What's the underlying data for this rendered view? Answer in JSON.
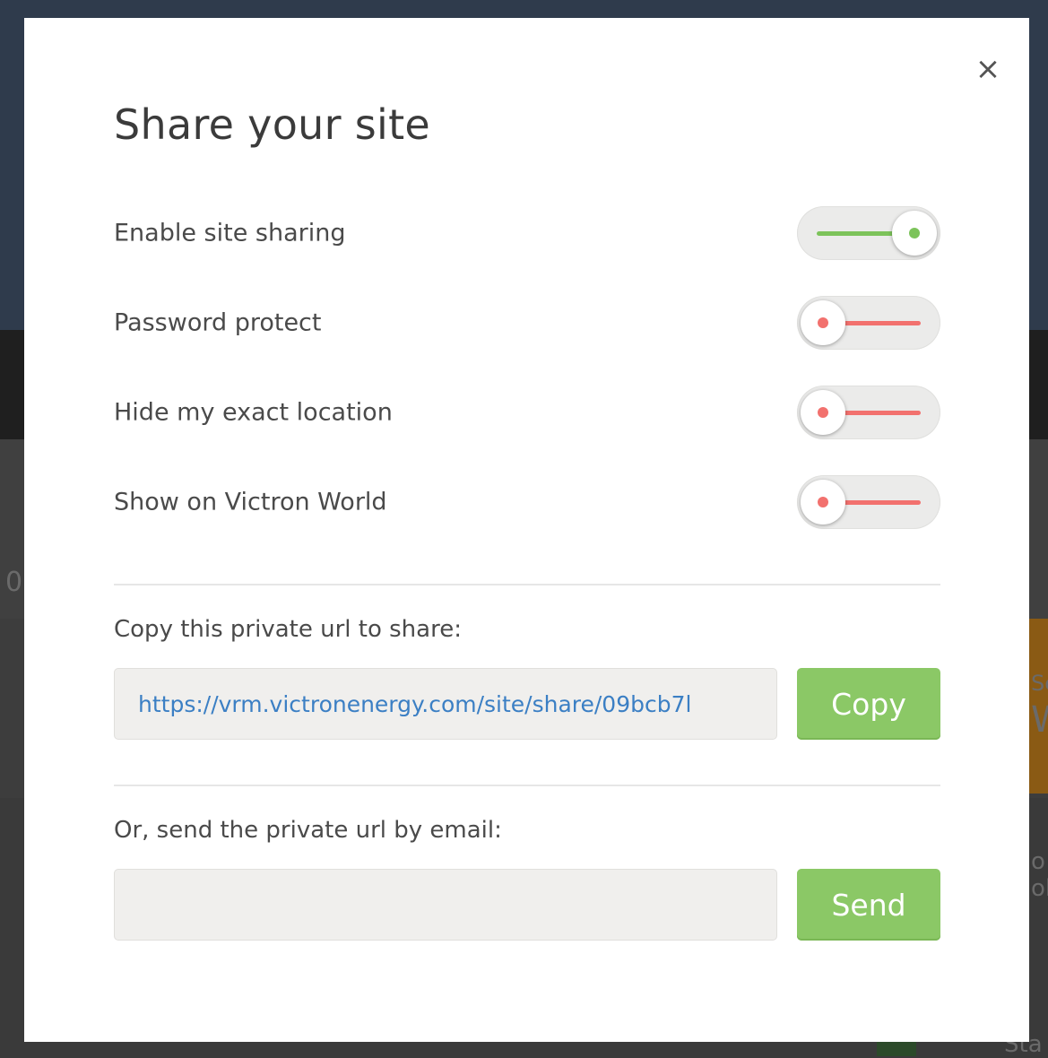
{
  "modal": {
    "title": "Share your site",
    "close_symbol": "×"
  },
  "toggles": [
    {
      "label": "Enable site sharing",
      "state": "on"
    },
    {
      "label": "Password protect",
      "state": "off"
    },
    {
      "label": "Hide my exact location",
      "state": "off"
    },
    {
      "label": "Show on Victron World",
      "state": "off"
    }
  ],
  "share_url": {
    "label": "Copy this private url to share:",
    "value": "https://vrm.victronenergy.com/site/share/09bcb7l",
    "button_label": "Copy"
  },
  "share_email": {
    "label": "Or, send the private url by email:",
    "value": "",
    "placeholder": "",
    "button_label": "Send"
  },
  "background_fragments": {
    "left_char": "0",
    "right_top": "Sc",
    "right_w": "W",
    "right_mid1": "o",
    "right_mid2": "ol",
    "bottom_right": "Sta"
  },
  "colors": {
    "toggle_on": "#7cc35a",
    "toggle_off": "#f2716e",
    "button_green": "#8bc866",
    "url_text": "#3b7fc4"
  }
}
